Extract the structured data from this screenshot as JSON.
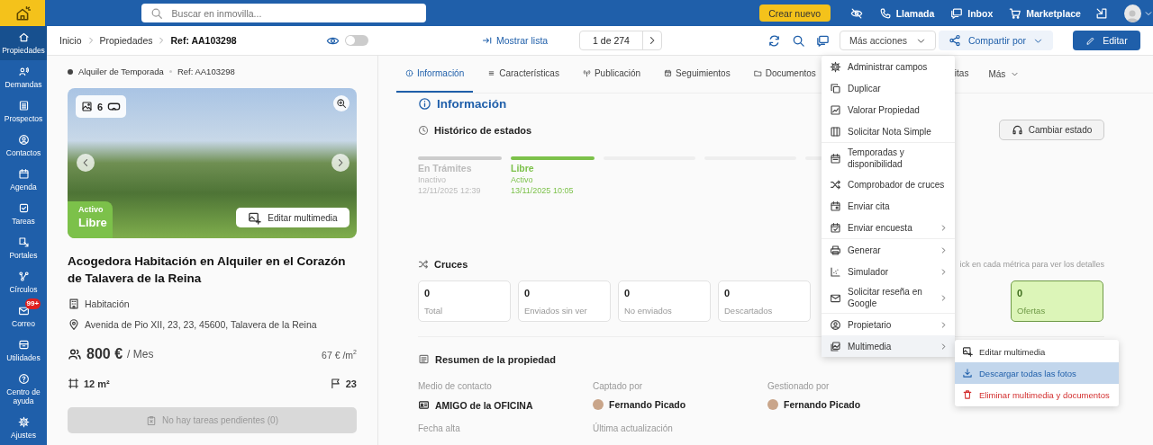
{
  "topbar": {
    "search": {
      "placeholder": "Buscar en inmovilla..."
    },
    "create_button": "Crear nuevo",
    "actions": [
      {
        "kind": "call",
        "label": "Llamada"
      },
      {
        "kind": "inbox",
        "label": "Inbox"
      },
      {
        "kind": "marketplace",
        "label": "Marketplace"
      }
    ]
  },
  "sidebar": {
    "items": [
      {
        "label": "Propiedades",
        "selected": true
      },
      {
        "label": "Demandas",
        "selected": false
      },
      {
        "label": "Prospectos",
        "selected": false
      },
      {
        "label": "Contactos",
        "selected": false
      },
      {
        "label": "Agenda",
        "selected": false
      },
      {
        "label": "Tareas",
        "selected": false
      },
      {
        "label": "Portales",
        "selected": false
      },
      {
        "label": "Círculos",
        "selected": false
      },
      {
        "label": "Correo",
        "selected": false,
        "badge": "99+"
      },
      {
        "label": "Utilidades",
        "selected": false
      },
      {
        "label": "Centro de ayuda",
        "selected": false
      },
      {
        "label": "Ajustes",
        "selected": false
      }
    ]
  },
  "subheader": {
    "breadcrumb": [
      "Inicio",
      "Propiedades",
      "Ref: AA103298"
    ],
    "preview_toggle": {
      "on": false
    },
    "show_list": "Mostrar lista",
    "pager": "1 de 274",
    "more_actions": "Más acciones",
    "share": "Compartir por",
    "edit": "Editar"
  },
  "property": {
    "operation": "Alquiler de Temporada",
    "ref": "Ref: AA103298",
    "photo_count": "6",
    "status_label": "Activo",
    "status": "Libre",
    "edit_media": "Editar multimedia",
    "title": "Acogedora Habitación en Alquiler en el Corazón de Talavera de la Reina",
    "type": "Habitación",
    "address": "Avenida de Pio XII, 23, 23, 45600, Talavera de la Reina",
    "price": "800 €",
    "price_unit": "/ Mes",
    "price_m2": "67 € /m$^{2}$",
    "area": "12 m²",
    "floor": "23",
    "tasks": {
      "label": "No hay tareas pendientes (0)",
      "disabled": true
    }
  },
  "tabs": [
    {
      "label": "Información",
      "selected": true
    },
    {
      "label": "Características",
      "selected": false
    },
    {
      "label": "Publicación",
      "selected": false
    },
    {
      "label": "Seguimientos",
      "selected": false
    },
    {
      "label": "Documentos",
      "selected": false
    },
    {
      "label": "itas",
      "selected": false
    }
  ],
  "more_tab": "Más",
  "info": {
    "heading": "Información",
    "history": {
      "title": "Histórico de estados",
      "change_button": "Cambiar estado",
      "states": [
        {
          "name": "En Trámites",
          "status": "Inactivo",
          "date": "12/11/2025 12:39",
          "active": false
        },
        {
          "name": "Libre",
          "status": "Activo",
          "date": "13/11/2025 10:05",
          "active": true
        }
      ]
    },
    "cruces": {
      "title": "Cruces",
      "hint": "ick en cada métrica para ver los detalles",
      "metrics": [
        {
          "value": "0",
          "label": "Total",
          "highlighted": false
        },
        {
          "value": "0",
          "label": "Enviados sin ver",
          "highlighted": false
        },
        {
          "value": "0",
          "label": "No enviados",
          "highlighted": false
        },
        {
          "value": "0",
          "label": "Descartados",
          "highlighted": false
        },
        {
          "value": "0",
          "label": "Ofertas",
          "highlighted": true
        }
      ]
    },
    "summary": {
      "title": "Resumen de la propiedad",
      "fields": [
        {
          "label": "Medio de contacto",
          "value": "AMIGO de la OFICINA",
          "kind": "source"
        },
        {
          "label": "Captado por",
          "value": "Fernando Picado",
          "kind": "person"
        },
        {
          "label": "Gestionado por",
          "value": "Fernando Picado",
          "kind": "person"
        },
        {
          "label": "Fecha alta"
        },
        {
          "label": "Última actualización"
        }
      ]
    }
  },
  "actions_menu": {
    "groups": [
      [
        {
          "label": "Administrar campos",
          "submenu": false,
          "expanded": false
        },
        {
          "label": "Duplicar",
          "submenu": false,
          "expanded": false
        },
        {
          "label": "Valorar Propiedad",
          "submenu": false,
          "expanded": false
        },
        {
          "label": "Solicitar Nota Simple",
          "submenu": false,
          "expanded": false
        }
      ],
      [
        {
          "label": "Temporadas y disponibilidad",
          "submenu": false,
          "expanded": false
        },
        {
          "label": "Comprobador de cruces",
          "submenu": false,
          "expanded": false
        },
        {
          "label": "Enviar cita",
          "submenu": false,
          "expanded": false
        },
        {
          "label": "Enviar encuesta",
          "submenu": true,
          "expanded": false
        }
      ],
      [
        {
          "label": "Generar",
          "submenu": true,
          "expanded": false
        },
        {
          "label": "Simulador",
          "submenu": true,
          "expanded": false
        },
        {
          "label": "Solicitar reseña en Google",
          "submenu": true,
          "expanded": false
        }
      ],
      [
        {
          "label": "Propietario",
          "submenu": true,
          "expanded": false
        },
        {
          "label": "Multimedia",
          "submenu": true,
          "expanded": true
        }
      ]
    ],
    "submenu": [
      {
        "label": "Editar multimedia",
        "kind": "normal",
        "selected": false
      },
      {
        "label": "Descargar todas las fotos",
        "kind": "normal",
        "selected": true
      },
      {
        "label": "Eliminar multimedia y documentos",
        "kind": "danger",
        "selected": false
      }
    ]
  }
}
